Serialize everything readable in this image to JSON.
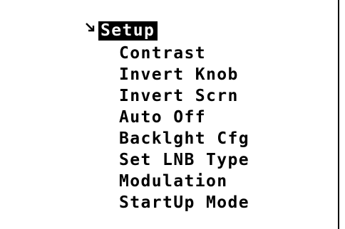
{
  "menu": {
    "title": "Setup",
    "cursor_icon": "selection-arrow-icon",
    "items": [
      {
        "label": "Contrast"
      },
      {
        "label": "Invert Knob"
      },
      {
        "label": "Invert Scrn"
      },
      {
        "label": "Auto Off"
      },
      {
        "label": "Backlght Cfg"
      },
      {
        "label": "Set LNB Type"
      },
      {
        "label": "Modulation"
      },
      {
        "label": "StartUp Mode"
      }
    ]
  }
}
